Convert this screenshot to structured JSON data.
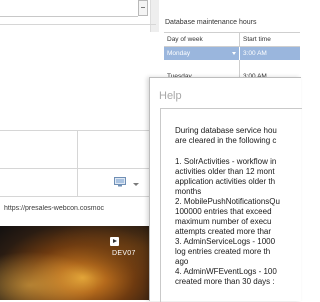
{
  "maintenance": {
    "title": "Database maintenance hours",
    "columns": [
      "Day of week",
      "Start time"
    ],
    "rows": [
      {
        "day": "Monday",
        "time": "3:00 AM",
        "selected": true
      },
      {
        "day": "Tuesday",
        "time": "3:00 AM",
        "selected": false
      }
    ]
  },
  "left": {
    "url_text": "https://presales-webcon.cosmoc",
    "video_label": "DEV07"
  },
  "help": {
    "title": "Help",
    "lines": [
      "During database service hou",
      "are cleared in the following c",
      "",
      "1. SolrActivities - workflow in",
      "activities older than 12 mont",
      "application activities older th",
      "months",
      "2. MobilePushNotificationsQu",
      "100000 entries that exceed",
      "maximum number of execu",
      "attempts created more thar",
      "3. AdminServiceLogs - 1000",
      "log entries created more th",
      "ago",
      "4. AdminWFEventLogs - 100",
      "created more than 30 days :"
    ]
  },
  "icons": {
    "monitor": "monitor-icon",
    "dropdown": "chevron-down-icon",
    "play": "play-icon"
  },
  "colors": {
    "selection": "#9ab6dd",
    "help_title": "#a8a8a8"
  }
}
